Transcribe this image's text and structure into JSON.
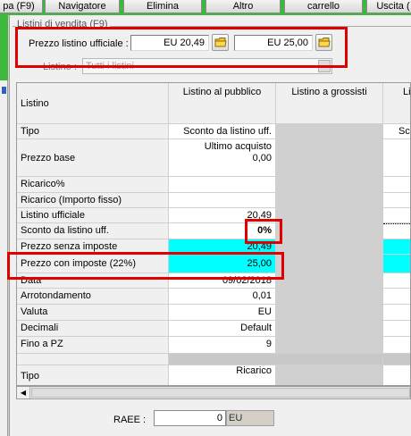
{
  "toolbar": {
    "buttons": [
      "pa (F9)",
      "Navigatore",
      "Elimina",
      "Altro",
      "carrello",
      "Uscita ("
    ]
  },
  "panel": {
    "title": "Listini di vendita (F9)",
    "prezzo_label": "Prezzo listino ufficiale :",
    "prezzo_value_1": "EU 20,49",
    "prezzo_value_2": "EU 25,00",
    "listino_label": "Listino :",
    "listino_value": "Tutti i listini"
  },
  "grid": {
    "header": {
      "label": "Listino",
      "col1": "Listino al pubblico",
      "col2": "Listino a grossisti",
      "col3": "Li"
    },
    "rows": [
      {
        "label": "Tipo",
        "v1": "Sconto da listino uff.",
        "v3": "Scon"
      },
      {
        "label": "Prezzo base",
        "v1a": "Ultimo acquisto",
        "v1": "0,00"
      },
      {
        "label": "Ricarico%",
        "v1": ""
      },
      {
        "label": "Ricarico (Importo fisso)",
        "v1": ""
      },
      {
        "label": "Listino ufficiale",
        "v1": "20,49"
      },
      {
        "label": "Sconto da listino uff.",
        "v1": "0%"
      },
      {
        "label": "Prezzo senza imposte",
        "v1": "20,49"
      },
      {
        "label": "Prezzo con imposte (22%)",
        "v1": "25,00"
      },
      {
        "label": "Data",
        "v1": "09/02/2018"
      },
      {
        "label": "Arrotondamento",
        "v1": "0,01"
      },
      {
        "label": "Valuta",
        "v1": "EU"
      },
      {
        "label": "Decimali",
        "v1": "Default"
      },
      {
        "label": "Fino a PZ",
        "v1": "9"
      },
      {
        "label": "",
        "v1": ""
      },
      {
        "label": "Tipo",
        "v1": "Ricarico"
      }
    ]
  },
  "raee": {
    "label": "RAEE :",
    "value": "0",
    "unit": "EU"
  },
  "colors": {
    "highlight_cyan": "#00ffff",
    "annotation_red": "#e00000",
    "header_green": "#3cb83c"
  }
}
